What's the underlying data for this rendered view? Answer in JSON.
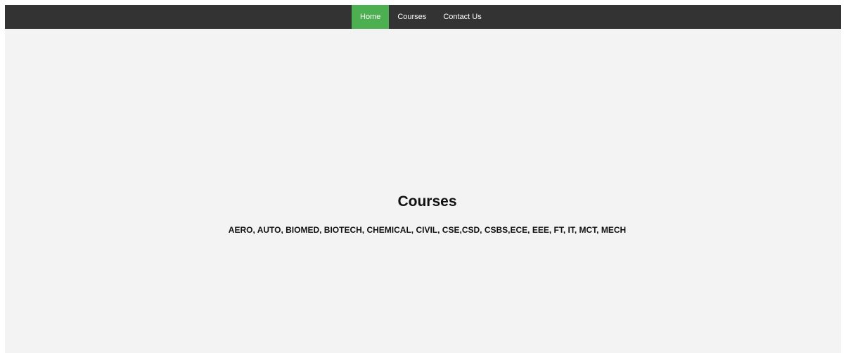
{
  "nav": {
    "items": [
      {
        "label": "Home",
        "active": true
      },
      {
        "label": "Courses",
        "active": false
      },
      {
        "label": "Contact Us",
        "active": false
      }
    ]
  },
  "main": {
    "title": "Courses",
    "courses": "AERO, AUTO, BIOMED, BIOTECH, CHEMICAL, CIVIL, CSE,CSD, CSBS,ECE, EEE, FT, IT, MCT, MECH"
  },
  "colors": {
    "navbar": "#333333",
    "active_tab": "#4caf50",
    "background": "#f3f3f3"
  }
}
